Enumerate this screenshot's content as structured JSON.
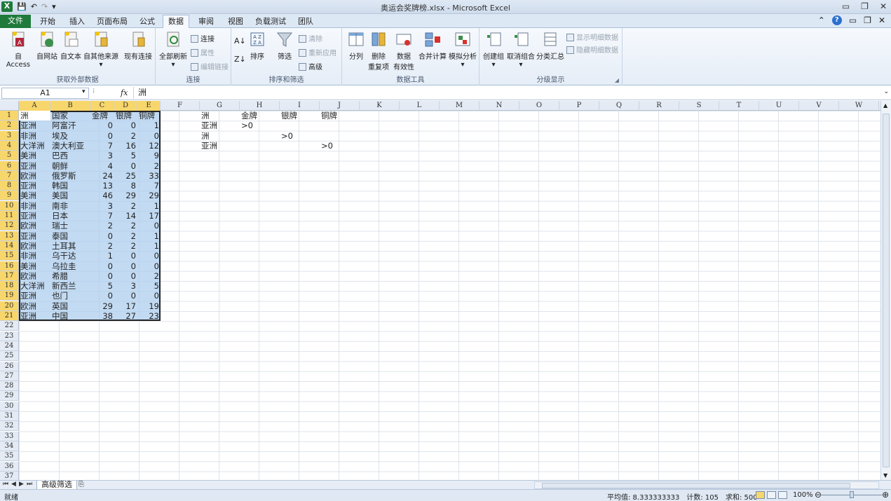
{
  "window": {
    "title": "奥运会奖牌榜.xlsx - Microsoft Excel",
    "qat_items": [
      "save-icon",
      "undo-icon",
      "redo-icon",
      "customize-icon"
    ]
  },
  "tabs": [
    {
      "label": "文件",
      "kind": "file"
    },
    {
      "label": "开始"
    },
    {
      "label": "插入"
    },
    {
      "label": "页面布局"
    },
    {
      "label": "公式"
    },
    {
      "label": "数据",
      "active": true
    },
    {
      "label": "审阅"
    },
    {
      "label": "视图"
    },
    {
      "label": "负载测试"
    },
    {
      "label": "团队"
    }
  ],
  "ribbon": {
    "groups": [
      {
        "label": "获取外部数据",
        "buttons": [
          "自 Access",
          "自网站",
          "自文本",
          "自其他来源",
          "现有连接"
        ]
      },
      {
        "label": "连接",
        "buttons": [
          "全部刷新"
        ],
        "small": [
          {
            "label": "连接",
            "enabled": true
          },
          {
            "label": "属性",
            "enabled": false
          },
          {
            "label": "编辑链接",
            "enabled": false
          }
        ]
      },
      {
        "label": "排序和筛选",
        "buttons": [
          "排序",
          "筛选"
        ],
        "small": [
          {
            "label": "清除",
            "enabled": false
          },
          {
            "label": "重新应用",
            "enabled": false
          },
          {
            "label": "高级",
            "enabled": true
          }
        ]
      },
      {
        "label": "数据工具",
        "buttons": [
          "分列",
          "删除\n重复项",
          "数据\n有效性",
          "合并计算",
          "模拟分析"
        ]
      },
      {
        "label": "分级显示",
        "buttons": [
          "创建组",
          "取消组合",
          "分类汇总"
        ],
        "small": [
          {
            "label": "显示明细数据",
            "enabled": false
          },
          {
            "label": "隐藏明细数据",
            "enabled": false
          }
        ]
      }
    ]
  },
  "formula_bar": {
    "name_box": "A1",
    "fx_label": "fx",
    "content": "洲"
  },
  "columns": [
    "A",
    "B",
    "C",
    "D",
    "E",
    "F",
    "G",
    "H",
    "I",
    "J",
    "K",
    "L",
    "M",
    "N",
    "O",
    "P",
    "Q",
    "R",
    "S",
    "T",
    "U",
    "V",
    "W"
  ],
  "rows_visible": 37,
  "table": {
    "headers": [
      "洲",
      "国家",
      "金牌",
      "银牌",
      "铜牌"
    ],
    "rows": [
      [
        "亚洲",
        "阿富汗",
        "0",
        "0",
        "1"
      ],
      [
        "非洲",
        "埃及",
        "0",
        "2",
        "0"
      ],
      [
        "大洋洲",
        "澳大利亚",
        "7",
        "16",
        "12"
      ],
      [
        "美洲",
        "巴西",
        "3",
        "5",
        "9"
      ],
      [
        "亚洲",
        "朝鲜",
        "4",
        "0",
        "2"
      ],
      [
        "欧洲",
        "俄罗斯",
        "24",
        "25",
        "33"
      ],
      [
        "亚洲",
        "韩国",
        "13",
        "8",
        "7"
      ],
      [
        "美洲",
        "美国",
        "46",
        "29",
        "29"
      ],
      [
        "非洲",
        "南非",
        "3",
        "2",
        "1"
      ],
      [
        "亚洲",
        "日本",
        "7",
        "14",
        "17"
      ],
      [
        "欧洲",
        "瑞士",
        "2",
        "2",
        "0"
      ],
      [
        "亚洲",
        "泰国",
        "0",
        "2",
        "1"
      ],
      [
        "欧洲",
        "土耳其",
        "2",
        "2",
        "1"
      ],
      [
        "非洲",
        "乌干达",
        "1",
        "0",
        "0"
      ],
      [
        "美洲",
        "乌拉圭",
        "0",
        "0",
        "0"
      ],
      [
        "欧洲",
        "希腊",
        "0",
        "0",
        "2"
      ],
      [
        "大洋洲",
        "新西兰",
        "5",
        "3",
        "5"
      ],
      [
        "亚洲",
        "也门",
        "0",
        "0",
        "0"
      ],
      [
        "欧洲",
        "英国",
        "29",
        "17",
        "19"
      ],
      [
        "亚洲",
        "中国",
        "38",
        "27",
        "23"
      ]
    ]
  },
  "criteria": {
    "headers": [
      "洲",
      "金牌",
      "银牌",
      "铜牌"
    ],
    "rows": [
      [
        "亚洲",
        ">0",
        "",
        ""
      ],
      [
        "洲",
        "",
        ">0",
        ""
      ],
      [
        "亚洲",
        "",
        "",
        ">0"
      ]
    ]
  },
  "sheet_tabs": [
    "高级筛选"
  ],
  "status": {
    "ready": "就绪",
    "average": "平均值: 8.333333333",
    "count": "计数: 105",
    "sum": "求和: 500",
    "zoom": "100%"
  }
}
